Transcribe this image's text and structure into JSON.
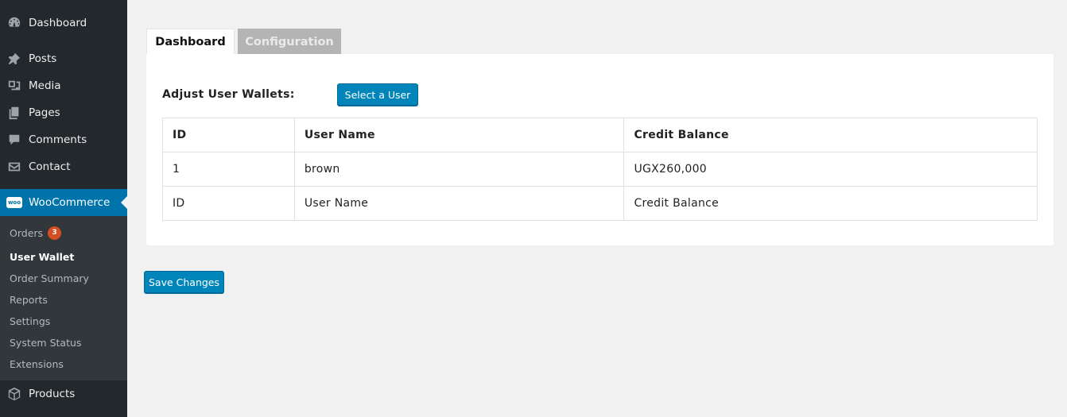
{
  "sidebar": {
    "top_items": [
      {
        "label": "Dashboard",
        "icon": "dashboard-icon"
      },
      {
        "label": "Posts",
        "icon": "pin-icon"
      },
      {
        "label": "Media",
        "icon": "media-icon"
      },
      {
        "label": "Pages",
        "icon": "pages-icon"
      },
      {
        "label": "Comments",
        "icon": "comment-icon"
      },
      {
        "label": "Contact",
        "icon": "envelope-icon"
      }
    ],
    "woocommerce": {
      "label": "WooCommerce",
      "icon_text": "woo"
    },
    "submenu": [
      {
        "label": "Orders",
        "badge": "3"
      },
      {
        "label": "User Wallet"
      },
      {
        "label": "Order Summary"
      },
      {
        "label": "Reports"
      },
      {
        "label": "Settings"
      },
      {
        "label": "System Status"
      },
      {
        "label": "Extensions"
      }
    ],
    "products": {
      "label": "Products",
      "icon": "box-icon"
    }
  },
  "tabs": [
    {
      "label": "Dashboard",
      "active": true
    },
    {
      "label": "Configuration",
      "active": false
    }
  ],
  "panel": {
    "adjust_label": "Adjust User Wallets:",
    "select_user_button": "Select a User",
    "table": {
      "headers": [
        "ID",
        "User Name",
        "Credit Balance"
      ],
      "rows": [
        [
          "1",
          "brown",
          "UGX260,000"
        ],
        [
          "ID",
          "User Name",
          "Credit Balance"
        ]
      ]
    }
  },
  "save_button": "Save Changes",
  "colors": {
    "sidebar_bg": "#23282d",
    "submenu_bg": "#32373c",
    "accent": "#0073aa",
    "button": "#0085ba",
    "badge": "#d54e21"
  }
}
